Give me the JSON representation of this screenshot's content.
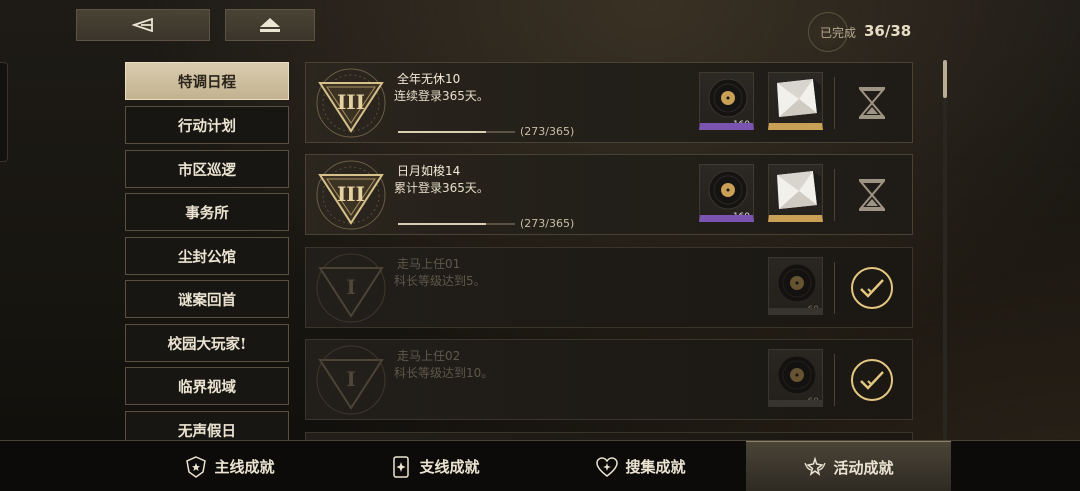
{
  "progress": {
    "label": "已完成",
    "count": "36/38"
  },
  "sidebar": {
    "items": [
      {
        "label": "特调日程",
        "active": true
      },
      {
        "label": "行动计划"
      },
      {
        "label": "市区巡逻"
      },
      {
        "label": "事务所"
      },
      {
        "label": "尘封公馆"
      },
      {
        "label": "谜案回首"
      },
      {
        "label": "校园大玩家!"
      },
      {
        "label": "临界视域"
      },
      {
        "label": "无声假日"
      }
    ]
  },
  "achievements": [
    {
      "title": "全年无休10",
      "desc": "连续登录365天。",
      "progress_text": "(273/365)",
      "progress": 0.748,
      "emblem": "tier-iii-emblem",
      "status": "hourglass-icon",
      "rewards": [
        {
          "icon": "vinyl-record-icon",
          "count": "160",
          "rarity": "purple"
        },
        {
          "icon": "envelope-card-icon",
          "count": "1",
          "rarity": "gold"
        }
      ]
    },
    {
      "title": "日月如梭14",
      "desc": "累计登录365天。",
      "progress_text": "(273/365)",
      "progress": 0.748,
      "emblem": "tier-iii-emblem",
      "status": "hourglass-icon",
      "rewards": [
        {
          "icon": "vinyl-record-icon",
          "count": "160",
          "rarity": "purple"
        },
        {
          "icon": "envelope-card-icon",
          "count": "1",
          "rarity": "gold"
        }
      ]
    },
    {
      "title": "走马上任01",
      "desc": "科长等级达到5。",
      "emblem": "tier-i-emblem",
      "status": "check-complete-icon",
      "rewards": [
        {
          "icon": "vinyl-record-icon",
          "count": "60",
          "rarity": "faded"
        }
      ]
    },
    {
      "title": "走马上任02",
      "desc": "科长等级达到10。",
      "emblem": "tier-i-emblem",
      "status": "check-complete-icon",
      "rewards": [
        {
          "icon": "vinyl-record-icon",
          "count": "60",
          "rarity": "faded"
        }
      ]
    }
  ],
  "tabs": [
    {
      "label": "主线成就",
      "icon": "shield-star-icon"
    },
    {
      "label": "支线成就",
      "icon": "card-star-icon"
    },
    {
      "label": "搜集成就",
      "icon": "heart-star-icon"
    },
    {
      "label": "活动成就",
      "icon": "winged-star-icon",
      "active": true
    }
  ],
  "colors": {
    "accent_gold": "#c9a055",
    "rarity_purple": "#7a54b0",
    "active_tab_bg": "#d9ccae"
  }
}
